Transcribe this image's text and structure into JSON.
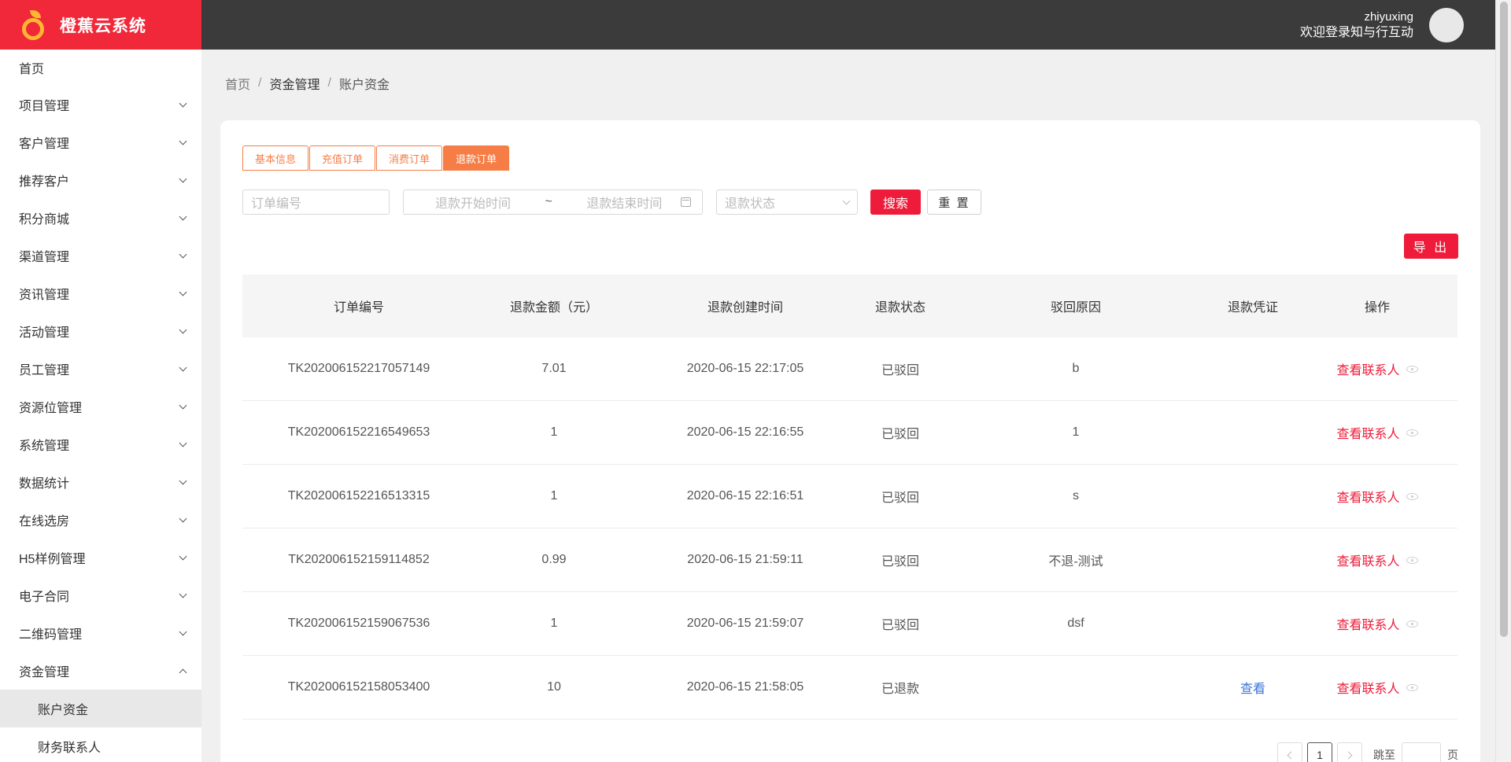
{
  "app": {
    "title": "橙蕉云系统"
  },
  "user": {
    "name": "zhiyuxing",
    "welcome": "欢迎登录知与行互动"
  },
  "sidebar": {
    "home": "首页",
    "items": [
      {
        "label": "项目管理"
      },
      {
        "label": "客户管理"
      },
      {
        "label": "推荐客户"
      },
      {
        "label": "积分商城"
      },
      {
        "label": "渠道管理"
      },
      {
        "label": "资讯管理"
      },
      {
        "label": "活动管理"
      },
      {
        "label": "员工管理"
      },
      {
        "label": "资源位管理"
      },
      {
        "label": "系统管理"
      },
      {
        "label": "数据统计"
      },
      {
        "label": "在线选房"
      },
      {
        "label": "H5样例管理"
      },
      {
        "label": "电子合同"
      },
      {
        "label": "二维码管理"
      }
    ],
    "expanded": {
      "label": "资金管理",
      "children": [
        {
          "label": "账户资金"
        },
        {
          "label": "财务联系人"
        }
      ]
    }
  },
  "breadcrumb": [
    "首页",
    "资金管理",
    "账户资金"
  ],
  "tabs": [
    "基本信息",
    "充值订单",
    "消费订单",
    "退款订单"
  ],
  "filters": {
    "order_placeholder": "订单编号",
    "start_placeholder": "退款开始时间",
    "range_sep": "~",
    "end_placeholder": "退款结束时间",
    "status_placeholder": "退款状态",
    "search_label": "搜索",
    "reset_label": "重 置"
  },
  "export_label": "导 出",
  "table": {
    "headers": [
      "订单编号",
      "退款金额（元）",
      "退款创建时间",
      "退款状态",
      "驳回原因",
      "退款凭证",
      "操作"
    ],
    "rows": [
      {
        "order": "TK202006152217057149",
        "amount": "7.01",
        "time": "2020-06-15 22:17:05",
        "status": "已驳回",
        "reason": "b",
        "voucher": "",
        "op": "查看联系人"
      },
      {
        "order": "TK202006152216549653",
        "amount": "1",
        "time": "2020-06-15 22:16:55",
        "status": "已驳回",
        "reason": "1",
        "voucher": "",
        "op": "查看联系人"
      },
      {
        "order": "TK202006152216513315",
        "amount": "1",
        "time": "2020-06-15 22:16:51",
        "status": "已驳回",
        "reason": "s",
        "voucher": "",
        "op": "查看联系人"
      },
      {
        "order": "TK202006152159114852",
        "amount": "0.99",
        "time": "2020-06-15 21:59:11",
        "status": "已驳回",
        "reason": "不退-测试",
        "voucher": "",
        "op": "查看联系人"
      },
      {
        "order": "TK202006152159067536",
        "amount": "1",
        "time": "2020-06-15 21:59:07",
        "status": "已驳回",
        "reason": "dsf",
        "voucher": "",
        "op": "查看联系人"
      },
      {
        "order": "TK202006152158053400",
        "amount": "10",
        "time": "2020-06-15 21:58:05",
        "status": "已退款",
        "reason": "",
        "voucher": "查看",
        "op": "查看联系人"
      }
    ]
  },
  "pagination": {
    "current": "1",
    "jump_label": "跳至",
    "page_unit": "页"
  },
  "colors": {
    "brand_red": "#f0283a",
    "accent_orange": "#f67e46",
    "header_dark": "#3b3b3b",
    "link_blue": "#3b74d6"
  }
}
